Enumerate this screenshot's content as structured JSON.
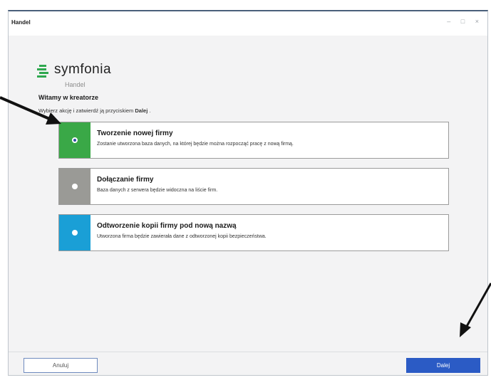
{
  "window": {
    "title": "Handel",
    "controls": [
      "–",
      "□",
      "×"
    ]
  },
  "logo": {
    "brand": "symfonia",
    "product": "Handel"
  },
  "wizard": {
    "heading": "Witamy w kreatorze",
    "instruction_prefix": "Wybierz akcję i zatwierdź ją przyciskiem ",
    "instruction_bold": "Dalej",
    "instruction_suffix": " ."
  },
  "options": [
    {
      "title": "Tworzenie nowej firmy",
      "description": "Zostanie utworzona baza danych, na której będzie można rozpocząć pracę z nową firmą.",
      "color": "#3aa847",
      "selected": true
    },
    {
      "title": "Dołączanie firmy",
      "description": "Baza danych z serwera będzie widoczna na liście firm.",
      "color": "#9a9a96",
      "selected": false
    },
    {
      "title": "Odtworzenie kopii firmy pod nową nazwą",
      "description": "Utworzona firma będzie zawierała dane z odtworzonej kopii bezpieczeństwa.",
      "color": "#1a9fd6",
      "selected": false
    }
  ],
  "buttons": {
    "cancel": "Anuluj",
    "next": "Dalej"
  },
  "colors": {
    "accent": "#2b5bc5",
    "logo_green": "#2fa84f"
  }
}
